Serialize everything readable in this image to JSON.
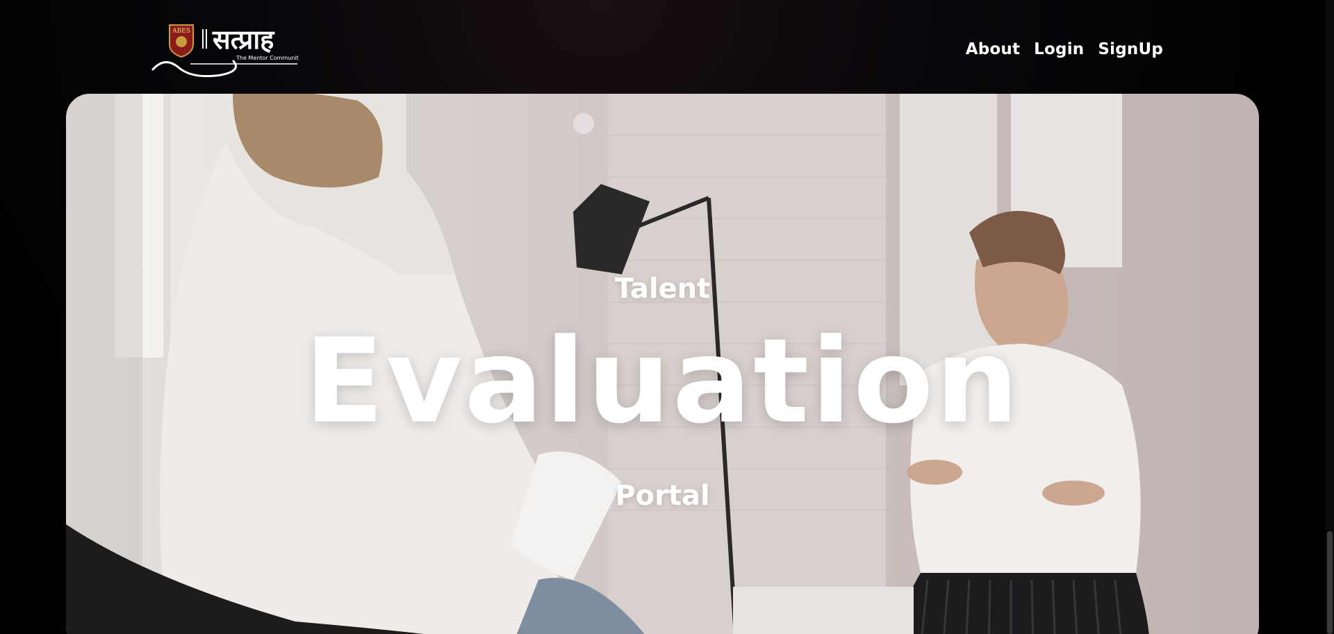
{
  "header": {
    "logo": {
      "badge_text": "ABES",
      "brand_text": "सत्प्राह",
      "tagline": "The Mentor Community"
    },
    "nav": [
      {
        "label": "About"
      },
      {
        "label": "Login"
      },
      {
        "label": "SignUp"
      }
    ]
  },
  "hero": {
    "line1": "Talent",
    "line2": "Evaluation",
    "line3": "Portal"
  },
  "colors": {
    "background": "#000000",
    "text": "#ffffff",
    "badge_gold": "#c89b3c",
    "badge_red": "#8b1a1a"
  }
}
